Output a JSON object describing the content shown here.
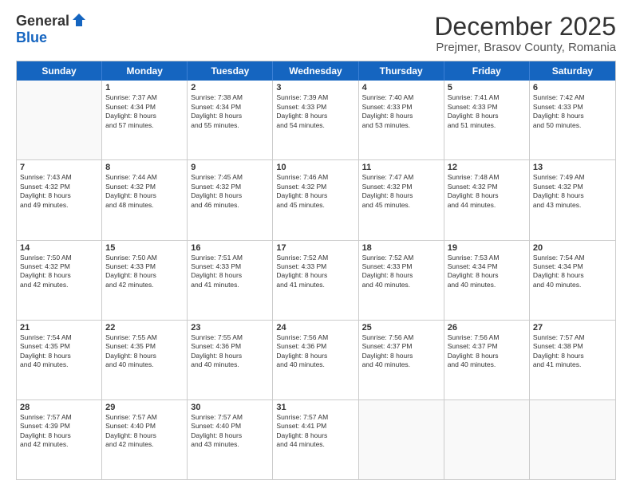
{
  "logo": {
    "general": "General",
    "blue": "Blue"
  },
  "title": "December 2025",
  "subtitle": "Prejmer, Brasov County, Romania",
  "header_days": [
    "Sunday",
    "Monday",
    "Tuesday",
    "Wednesday",
    "Thursday",
    "Friday",
    "Saturday"
  ],
  "weeks": [
    [
      {
        "day": "",
        "info": ""
      },
      {
        "day": "1",
        "info": "Sunrise: 7:37 AM\nSunset: 4:34 PM\nDaylight: 8 hours\nand 57 minutes."
      },
      {
        "day": "2",
        "info": "Sunrise: 7:38 AM\nSunset: 4:34 PM\nDaylight: 8 hours\nand 55 minutes."
      },
      {
        "day": "3",
        "info": "Sunrise: 7:39 AM\nSunset: 4:33 PM\nDaylight: 8 hours\nand 54 minutes."
      },
      {
        "day": "4",
        "info": "Sunrise: 7:40 AM\nSunset: 4:33 PM\nDaylight: 8 hours\nand 53 minutes."
      },
      {
        "day": "5",
        "info": "Sunrise: 7:41 AM\nSunset: 4:33 PM\nDaylight: 8 hours\nand 51 minutes."
      },
      {
        "day": "6",
        "info": "Sunrise: 7:42 AM\nSunset: 4:33 PM\nDaylight: 8 hours\nand 50 minutes."
      }
    ],
    [
      {
        "day": "7",
        "info": "Sunrise: 7:43 AM\nSunset: 4:32 PM\nDaylight: 8 hours\nand 49 minutes."
      },
      {
        "day": "8",
        "info": "Sunrise: 7:44 AM\nSunset: 4:32 PM\nDaylight: 8 hours\nand 48 minutes."
      },
      {
        "day": "9",
        "info": "Sunrise: 7:45 AM\nSunset: 4:32 PM\nDaylight: 8 hours\nand 46 minutes."
      },
      {
        "day": "10",
        "info": "Sunrise: 7:46 AM\nSunset: 4:32 PM\nDaylight: 8 hours\nand 45 minutes."
      },
      {
        "day": "11",
        "info": "Sunrise: 7:47 AM\nSunset: 4:32 PM\nDaylight: 8 hours\nand 45 minutes."
      },
      {
        "day": "12",
        "info": "Sunrise: 7:48 AM\nSunset: 4:32 PM\nDaylight: 8 hours\nand 44 minutes."
      },
      {
        "day": "13",
        "info": "Sunrise: 7:49 AM\nSunset: 4:32 PM\nDaylight: 8 hours\nand 43 minutes."
      }
    ],
    [
      {
        "day": "14",
        "info": "Sunrise: 7:50 AM\nSunset: 4:32 PM\nDaylight: 8 hours\nand 42 minutes."
      },
      {
        "day": "15",
        "info": "Sunrise: 7:50 AM\nSunset: 4:33 PM\nDaylight: 8 hours\nand 42 minutes."
      },
      {
        "day": "16",
        "info": "Sunrise: 7:51 AM\nSunset: 4:33 PM\nDaylight: 8 hours\nand 41 minutes."
      },
      {
        "day": "17",
        "info": "Sunrise: 7:52 AM\nSunset: 4:33 PM\nDaylight: 8 hours\nand 41 minutes."
      },
      {
        "day": "18",
        "info": "Sunrise: 7:52 AM\nSunset: 4:33 PM\nDaylight: 8 hours\nand 40 minutes."
      },
      {
        "day": "19",
        "info": "Sunrise: 7:53 AM\nSunset: 4:34 PM\nDaylight: 8 hours\nand 40 minutes."
      },
      {
        "day": "20",
        "info": "Sunrise: 7:54 AM\nSunset: 4:34 PM\nDaylight: 8 hours\nand 40 minutes."
      }
    ],
    [
      {
        "day": "21",
        "info": "Sunrise: 7:54 AM\nSunset: 4:35 PM\nDaylight: 8 hours\nand 40 minutes."
      },
      {
        "day": "22",
        "info": "Sunrise: 7:55 AM\nSunset: 4:35 PM\nDaylight: 8 hours\nand 40 minutes."
      },
      {
        "day": "23",
        "info": "Sunrise: 7:55 AM\nSunset: 4:36 PM\nDaylight: 8 hours\nand 40 minutes."
      },
      {
        "day": "24",
        "info": "Sunrise: 7:56 AM\nSunset: 4:36 PM\nDaylight: 8 hours\nand 40 minutes."
      },
      {
        "day": "25",
        "info": "Sunrise: 7:56 AM\nSunset: 4:37 PM\nDaylight: 8 hours\nand 40 minutes."
      },
      {
        "day": "26",
        "info": "Sunrise: 7:56 AM\nSunset: 4:37 PM\nDaylight: 8 hours\nand 40 minutes."
      },
      {
        "day": "27",
        "info": "Sunrise: 7:57 AM\nSunset: 4:38 PM\nDaylight: 8 hours\nand 41 minutes."
      }
    ],
    [
      {
        "day": "28",
        "info": "Sunrise: 7:57 AM\nSunset: 4:39 PM\nDaylight: 8 hours\nand 42 minutes."
      },
      {
        "day": "29",
        "info": "Sunrise: 7:57 AM\nSunset: 4:40 PM\nDaylight: 8 hours\nand 42 minutes."
      },
      {
        "day": "30",
        "info": "Sunrise: 7:57 AM\nSunset: 4:40 PM\nDaylight: 8 hours\nand 43 minutes."
      },
      {
        "day": "31",
        "info": "Sunrise: 7:57 AM\nSunset: 4:41 PM\nDaylight: 8 hours\nand 44 minutes."
      },
      {
        "day": "",
        "info": ""
      },
      {
        "day": "",
        "info": ""
      },
      {
        "day": "",
        "info": ""
      }
    ]
  ]
}
